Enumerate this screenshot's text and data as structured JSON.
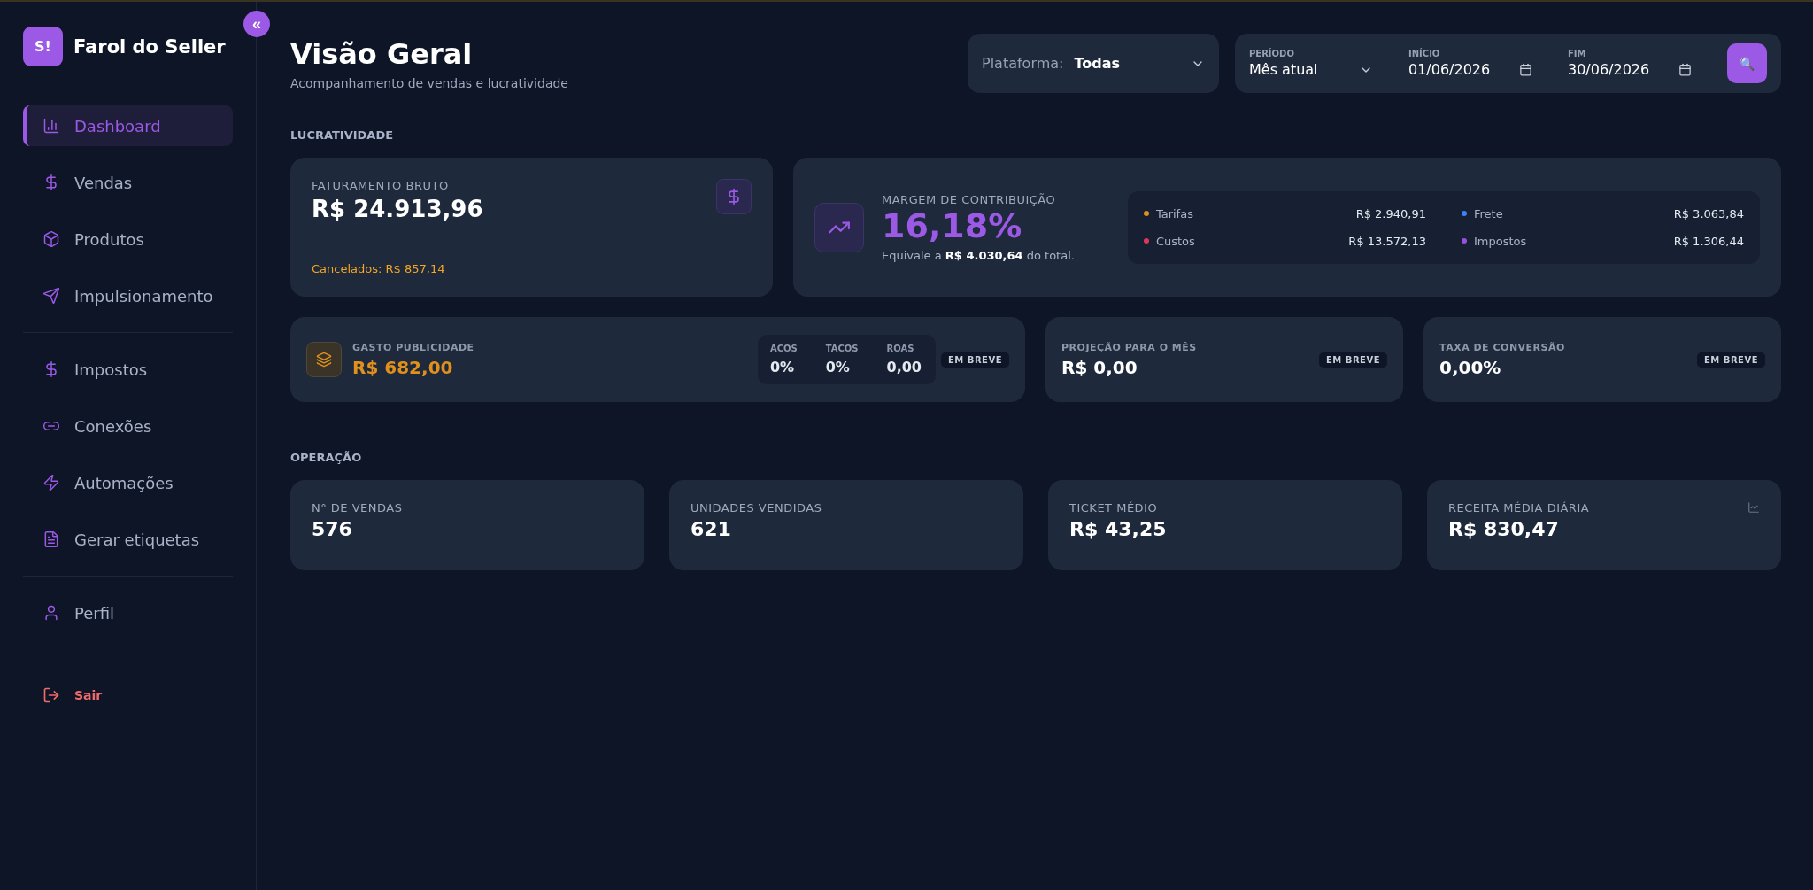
{
  "sidebar": {
    "logo_mark": "S!",
    "brand": "Farol do Seller",
    "collapse": "«",
    "groups": [
      [
        {
          "label": "Dashboard",
          "selected": true
        },
        {
          "label": "Vendas",
          "selected": false
        },
        {
          "label": "Produtos",
          "selected": false
        },
        {
          "label": "Impulsionamento",
          "selected": false
        }
      ],
      [
        {
          "label": "Impostos",
          "selected": false
        },
        {
          "label": "Conexões",
          "selected": false
        },
        {
          "label": "Automações",
          "selected": false
        },
        {
          "label": "Gerar etiquetas",
          "selected": false
        }
      ],
      [
        {
          "label": "Perfil",
          "selected": false
        }
      ]
    ],
    "logout": "Sair"
  },
  "header": {
    "title": "Visão Geral",
    "subtitle": "Acompanhamento de vendas e lucratividade",
    "platform": {
      "label": "Plataforma:",
      "value": "Todas"
    },
    "period": {
      "label": "PERÍODO",
      "value": "Mês atual"
    },
    "start": {
      "label": "INÍCIO",
      "value": "01/06/2026"
    },
    "end": {
      "label": "FIM",
      "value": "30/06/2026"
    },
    "search_icon": "🔍"
  },
  "profit": {
    "title": "LUCRATIVIDADE",
    "revenue": {
      "label": "FATURAMENTO BRUTO",
      "value": "R$ 24.913,96",
      "cancelled": "Cancelados: R$ 857,14"
    },
    "margin": {
      "label": "MARGEM DE CONTRIBUIÇÃO",
      "value": "16,18%",
      "note": "Equivale a **R$ 4.030,64** do total.",
      "breakdown": [
        {
          "name": "Tarifas",
          "value": "R$ 2.940,91",
          "color": "#e0901c"
        },
        {
          "name": "Frete",
          "value": "R$ 3.063,84",
          "color": "#3b82f6"
        },
        {
          "name": "Custos",
          "value": "R$ 13.572,13",
          "color": "#e0365a"
        },
        {
          "name": "Impostos",
          "value": "R$ 1.306,44",
          "color": "#9b4fe0"
        }
      ]
    },
    "ads": {
      "label": "GASTO PUBLICIDADE",
      "value": "R$ 682,00",
      "metrics": [
        {
          "label": "ACOS",
          "value": "0%"
        },
        {
          "label": "TACOS",
          "value": "0%"
        },
        {
          "label": "ROAS",
          "value": "0,00"
        }
      ],
      "badge": "EM BREVE"
    },
    "projection": {
      "label": "PROJEÇÃO PARA O MÊS",
      "value": "R$ 0,00",
      "badge": "EM BREVE"
    },
    "conversion": {
      "label": "TAXA DE CONVERSÃO",
      "value": "0,00%",
      "badge": "EM BREVE"
    }
  },
  "operation": {
    "title": "OPERAÇÃO",
    "cards": [
      {
        "label": "N° DE VENDAS",
        "value": "576"
      },
      {
        "label": "UNIDADES VENDIDAS",
        "value": "621"
      },
      {
        "label": "TICKET MÉDIO",
        "value": "R$ 43,25"
      },
      {
        "label": "RECEITA MÉDIA DIÁRIA",
        "value": "R$ 830,47"
      }
    ]
  }
}
